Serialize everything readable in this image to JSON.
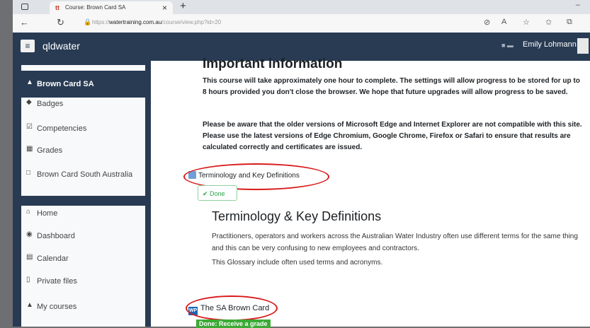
{
  "browser": {
    "tab_title": "Course: Brown Card SA",
    "tab_favicon": "tt",
    "tab_close": "×",
    "new_tab": "+",
    "minimize": "–",
    "url_prefix": "https://",
    "url_domain": "watertraining.com.au",
    "url_path": "/course/view.php?id=20"
  },
  "navbar": {
    "brand": "qldwater",
    "user_name": "Emily Lohmann"
  },
  "sidebar": {
    "items": [
      {
        "label": "Brown Card SA",
        "icon": "graduation-cap-icon",
        "glyph": "🎓"
      },
      {
        "label": "Badges",
        "icon": "shield-icon",
        "glyph": "◆"
      },
      {
        "label": "Competencies",
        "icon": "checkbox-icon",
        "glyph": "☑"
      },
      {
        "label": "Grades",
        "icon": "table-icon",
        "glyph": "▦"
      },
      {
        "label": "Brown Card South Australia",
        "icon": "folder-icon",
        "glyph": "□"
      },
      {
        "label": "Home",
        "icon": "home-icon",
        "glyph": "⌂"
      },
      {
        "label": "Dashboard",
        "icon": "dashboard-icon",
        "glyph": "◉"
      },
      {
        "label": "Calendar",
        "icon": "calendar-icon",
        "glyph": "▤"
      },
      {
        "label": "Private files",
        "icon": "file-icon",
        "glyph": "▯"
      },
      {
        "label": "My courses",
        "icon": "graduation-cap-icon",
        "glyph": "🎓"
      }
    ]
  },
  "main": {
    "important_heading": "Important information",
    "important_para1": "This course will take approximately one hour to complete. The settings will allow progress to be stored for up to 8 hours provided you don't close the browser. We hope that future upgrades will allow progress to be saved.",
    "important_para2": "Please be aware that the older versions of Microsoft Edge and Internet Explorer are not compatible with this site. Please use the latest versions of Edge Chromium, Google Chrome, Firefox or Safari to ensure that results are calculated correctly and certificates are issued.",
    "activity1_label": "Terminology and Key Definitions",
    "activity1_status": "Done",
    "term_heading": "Terminology & Key Definitions",
    "term_para1": "Practitioners, operators and workers across the Australian Water Industry often use different terms for the same thing and this can be very confusing to new employees and contractors.",
    "term_para2": "This Glossary include often used terms and acronyms.",
    "activity2_logo": "WP",
    "activity2_label": "The SA Brown Card",
    "activity2_status": "Done: Receive a grade"
  },
  "colors": {
    "navbar": "#283b53",
    "highlight_oval": "#d91b1b",
    "done_green": "#3aaa35"
  }
}
